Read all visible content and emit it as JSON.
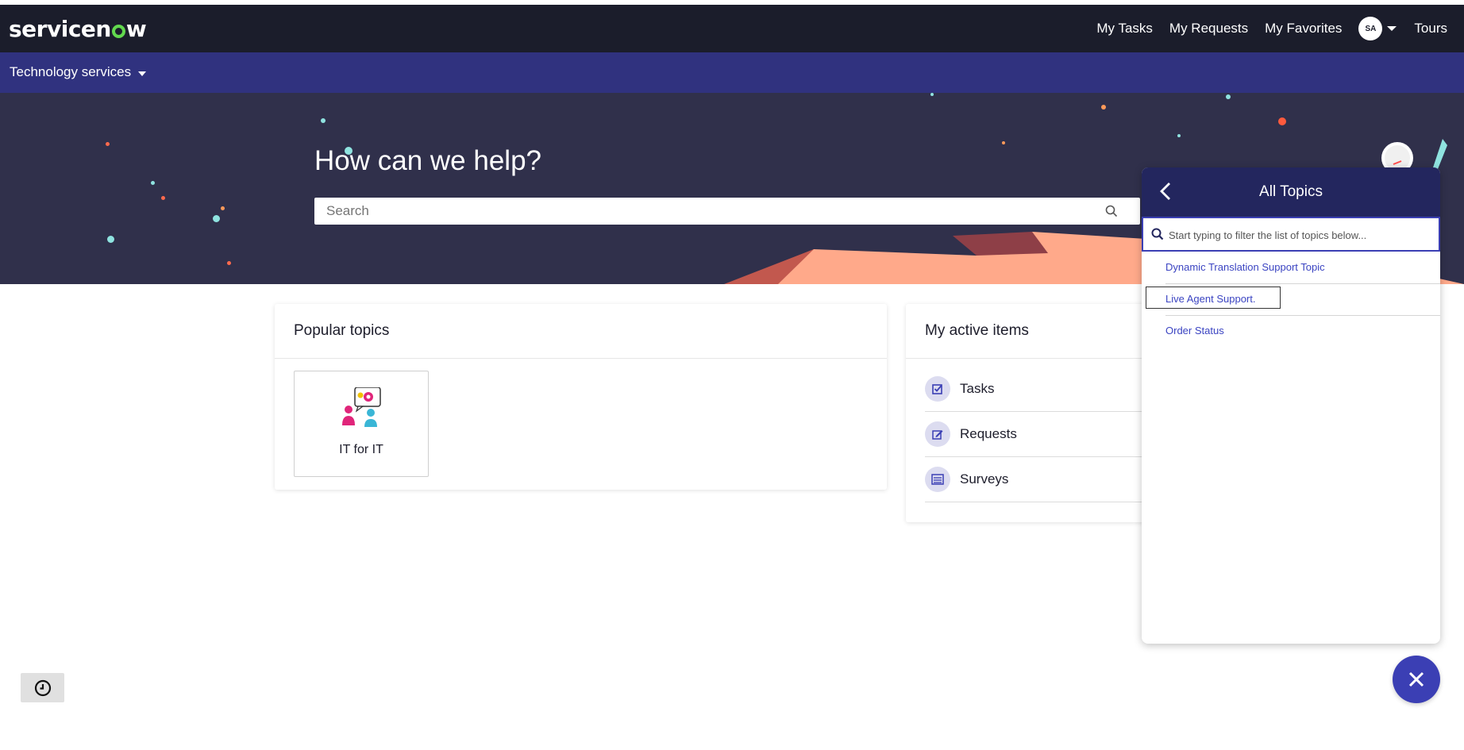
{
  "header": {
    "logo_text_pre": "servicen",
    "logo_text_post": "w",
    "nav": [
      "My Tasks",
      "My Requests",
      "My Favorites"
    ],
    "avatar_initials": "SA",
    "tours_label": "Tours"
  },
  "subnav": {
    "label": "Technology services"
  },
  "hero": {
    "title": "How can we help?",
    "search_placeholder": "Search"
  },
  "popular": {
    "title": "Popular topics",
    "tiles": [
      {
        "label": "IT for IT",
        "icon": "people-gear-icon"
      }
    ]
  },
  "active": {
    "title": "My active items",
    "items": [
      {
        "label": "Tasks",
        "icon": "checkbox-icon"
      },
      {
        "label": "Requests",
        "icon": "edit-icon"
      },
      {
        "label": "Surveys",
        "icon": "list-icon"
      }
    ]
  },
  "topics_panel": {
    "title": "All Topics",
    "filter_placeholder": "Start typing to filter the list of topics below...",
    "items": [
      "Dynamic Translation Support Topic",
      "Live Agent Support.",
      "Order Status"
    ],
    "focused_index": 1
  },
  "colors": {
    "topbar": "#1b1d2b",
    "subbar": "#30327f",
    "hero": "#30304b",
    "panel_header": "#23265e",
    "accent": "#3b3fb4",
    "link": "#3b44c2",
    "logo_o": "#62d84e"
  }
}
